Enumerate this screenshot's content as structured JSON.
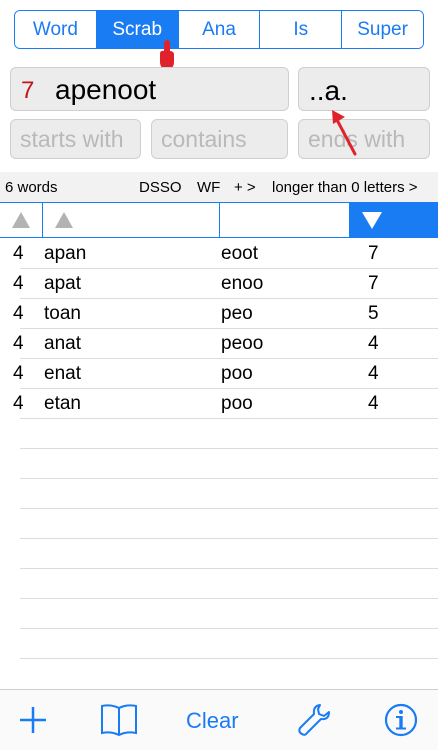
{
  "segments": [
    {
      "label": "Word",
      "active": false
    },
    {
      "label": "Scrab",
      "active": true
    },
    {
      "label": "Ana",
      "active": false
    },
    {
      "label": "Is",
      "active": false
    },
    {
      "label": "Super",
      "active": false
    }
  ],
  "search": {
    "letter_count": "7",
    "letters": "apenoot",
    "pattern": "..a.",
    "starts_with_placeholder": "starts with",
    "contains_placeholder": "contains",
    "ends_with_placeholder": "ends with"
  },
  "status": {
    "count": "6 words",
    "dsso": "DSSO",
    "wf": "WF",
    "plus": "+ >",
    "longer": "longer than 0 letters >"
  },
  "results": [
    {
      "len": "4",
      "word": "apan",
      "rest": "eoot",
      "score": "7"
    },
    {
      "len": "4",
      "word": "apat",
      "rest": "enoo",
      "score": "7"
    },
    {
      "len": "4",
      "word": "toan",
      "rest": "peo",
      "score": "5"
    },
    {
      "len": "4",
      "word": "anat",
      "rest": "peoo",
      "score": "4"
    },
    {
      "len": "4",
      "word": "enat",
      "rest": "poo",
      "score": "4"
    },
    {
      "len": "4",
      "word": "etan",
      "rest": "poo",
      "score": "4"
    }
  ],
  "toolbar": {
    "add_icon": "plus-icon",
    "dictionary_icon": "book-icon",
    "clear_label": "Clear",
    "settings_icon": "wrench-icon",
    "info_icon": "info-icon"
  },
  "colors": {
    "accent": "#1a7cf2",
    "letter_count": "#c0161a",
    "annotation": "#e0232b"
  }
}
